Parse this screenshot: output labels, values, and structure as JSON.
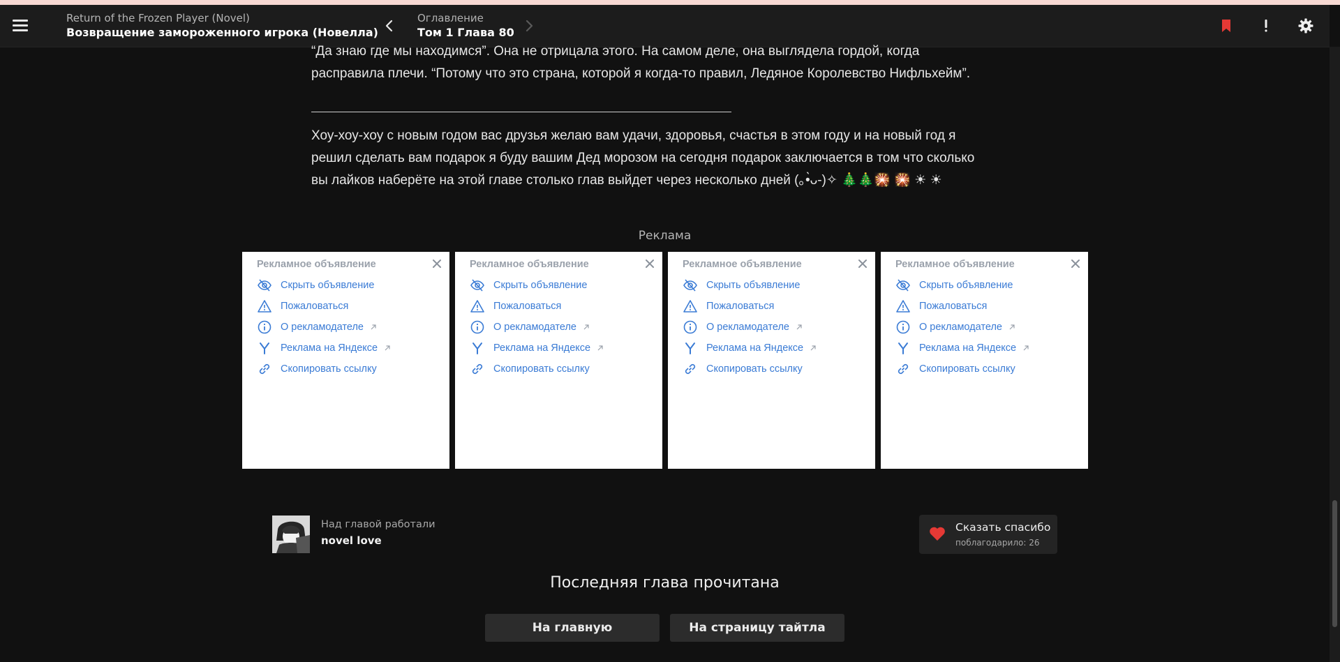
{
  "header": {
    "title_en": "Return of the Frozen Player (Novel)",
    "title_ru": "Возвращение замороженного игрока (Новелла)",
    "toc_label": "Оглавление",
    "chapter": "Том 1 Глава 80",
    "icons": [
      "menu-icon",
      "chevron-left-icon",
      "chevron-right-icon",
      "bookmark-icon",
      "report-icon",
      "gear-icon"
    ],
    "bookmark_color": "#e53935"
  },
  "chapter_text": {
    "line1": "“Да знаю где мы находимся”. Она не отрицала этого. На самом деле, она выглядела гордой, когда",
    "line2": "расправила плечи. “Потому что это страна, которой я когда-то правил, Ледяное Королевство Нифльхейм”.",
    "note_line1": "Хоу-хоу-хоу с новым годом вас друзья желаю вам удачи, здоровья, счастья в этом году и на новый год я",
    "note_line2": "решил сделать вам подарок я буду вашим Дед морозом на сегодня подарок заключается в том что сколько",
    "note_line3": "вы лайков наберёте на этой главе столько глав выйдет через несколько дней (｡•̀ᴗ-)✧ 🎄🎄🎇 🎇 ☀ ☀"
  },
  "ads": {
    "label": "Реклама",
    "cards": [
      {
        "title": "Рекламное объявление",
        "hide": "Скрыть объявление",
        "report": "Пожаловаться",
        "about": "О рекламодателе",
        "yandex": "Реклама на Яндексе",
        "copy": "Скопировать ссылку"
      },
      {
        "title": "Рекламное объявление",
        "hide": "Скрыть объявление",
        "report": "Пожаловаться",
        "about": "О рекламодателе",
        "yandex": "Реклама на Яндексе",
        "copy": "Скопировать ссылку"
      },
      {
        "title": "Рекламное объявление",
        "hide": "Скрыть объявление",
        "report": "Пожаловаться",
        "about": "О рекламодателе",
        "yandex": "Реклама на Яндексе",
        "copy": "Скопировать ссылку"
      },
      {
        "title": "Рекламное объявление",
        "hide": "Скрыть объявление",
        "report": "Пожаловаться",
        "about": "О рекламодателе",
        "yandex": "Реклама на Яндексе",
        "copy": "Скопировать ссылку"
      }
    ],
    "link_color": "#3a7bd5"
  },
  "credits": {
    "label": "Над главой работали",
    "name": "novel love"
  },
  "thanks": {
    "title": "Сказать спасибо",
    "count": "поблагодарило: 26",
    "heart_color": "#e53935"
  },
  "footer": {
    "last_read": "Последняя глава прочитана",
    "home_button": "На главную",
    "title_page_button": "На страницу тайтла"
  }
}
